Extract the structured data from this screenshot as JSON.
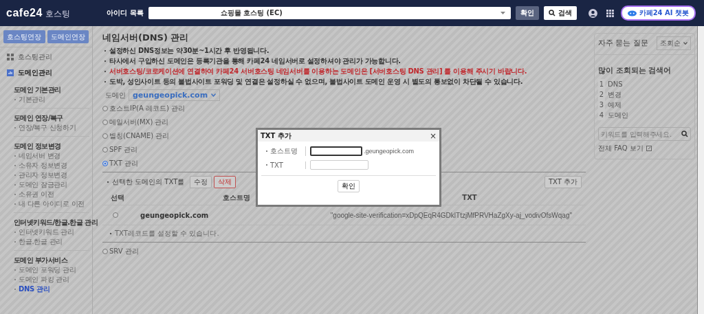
{
  "header": {
    "logo": "cafe24",
    "logo_suffix": "호스팅",
    "id_label": "아이디 목록",
    "id_value": "쇼핑몰 호스팅 (EC)",
    "confirm": "확인",
    "search": "검색",
    "chatbot": "카페24 AI 챗봇"
  },
  "sidebar": {
    "buttons": [
      "호스팅연장",
      "도메인연장"
    ],
    "nav": [
      {
        "label": "호스팅관리",
        "selected": false
      },
      {
        "label": "도메인관리",
        "selected": true
      }
    ],
    "groups": [
      {
        "title": "도메인 기본관리",
        "links": [
          {
            "label": "기본관리",
            "selected": false
          }
        ]
      },
      {
        "title": "도메인 연장/복구",
        "links": [
          {
            "label": "연장/복구 신청하기",
            "selected": false
          }
        ]
      },
      {
        "title": "도메인 정보변경",
        "links": [
          {
            "label": "네임서버 변경",
            "selected": false
          },
          {
            "label": "소유자 정보변경",
            "selected": false
          },
          {
            "label": "관리자 정보변경",
            "selected": false
          },
          {
            "label": "도메인 잠금관리",
            "selected": false
          },
          {
            "label": "소유권 이전",
            "selected": false
          },
          {
            "label": "내 다른 아이디로 이전",
            "selected": false
          }
        ]
      },
      {
        "title": "인터넷키워드/한글.한글 관리",
        "links": [
          {
            "label": "인터넷키워드 관리",
            "selected": false
          },
          {
            "label": "한글.한글 관리",
            "selected": false
          }
        ]
      },
      {
        "title": "도메인 부가서비스",
        "links": [
          {
            "label": "도메인 포워딩 관리",
            "selected": false
          },
          {
            "label": "도메인 파킹 관리",
            "selected": false
          },
          {
            "label": "DNS 관리",
            "selected": true
          }
        ]
      }
    ]
  },
  "main": {
    "title": "네임서버(DNS) 관리",
    "notices": [
      {
        "kind": "normal",
        "text": "설정하신 DNS정보는 **약30분~1시간 후 반영**됩니다."
      },
      {
        "kind": "normal",
        "text": "타사에서 구입하신 도메인은 등록기관을 통해 **카페24 네임서버로 설정**하셔야 관리가 가능합니다."
      },
      {
        "kind": "warning",
        "text": "서버호스팅/코로케이션에 연결하여 **카페24 서버호스팅 네임서버를 이용하는 도메인은 [서버호스팅 DNS 관리]** 를 이용해 주시기 바랍니다."
      },
      {
        "kind": "normal",
        "text": "도박, 성인사이트 등의 불법사이트 포워딩 및 연결은 설정하실 수 없으며, 불법사이트 도메인 운영 시 별도의 통보없이 차단될 수 있습니다."
      }
    ],
    "domain_label": "도메인",
    "domain_value": "geungeopick.com",
    "record_types": [
      {
        "label": "호스트IP(A 레코드) 관리",
        "selected": false
      },
      {
        "label": "메일서버(MX) 관리",
        "selected": false
      },
      {
        "label": "별칭(CNAME) 관리",
        "selected": false
      },
      {
        "label": "SPF 관리",
        "selected": false
      },
      {
        "label": "TXT 관리",
        "selected": true
      },
      {
        "label": "SRV 관리",
        "selected": false
      }
    ],
    "txt_panel": {
      "caption": "선택한 도메인의 TXT를",
      "edit": "수정",
      "delete": "삭제",
      "add": "TXT 추가",
      "columns": [
        "선택",
        "호스트명",
        "TXT"
      ],
      "rows": [
        {
          "selected": false,
          "host": "geungeopick.com",
          "txt": "\"google-site-verification=xDpQEqR4GDklTtzjMfPRVHaZgXy-aj_vodivOfsWqag\""
        }
      ],
      "note": "TXT레코드를 설정할 수 있습니다."
    }
  },
  "faq": {
    "title": "자주 묻는 질문",
    "sort": "조회순",
    "popular_title": "많이 조회되는 검색어",
    "popular": [
      {
        "rank": "1",
        "label": "DNS"
      },
      {
        "rank": "2",
        "label": "변경"
      },
      {
        "rank": "3",
        "label": "예제"
      },
      {
        "rank": "4",
        "label": "도메인"
      }
    ],
    "search_placeholder": "키워드를 입력해주세요.",
    "all_link": "전체 FAQ 보기"
  },
  "modal": {
    "title": "TXT 추가",
    "close": "×",
    "fields": [
      {
        "label": "호스트명",
        "focused": true,
        "suffix": ".geungeopick.com"
      },
      {
        "label": "TXT",
        "focused": false
      }
    ],
    "confirm": "확인"
  }
}
